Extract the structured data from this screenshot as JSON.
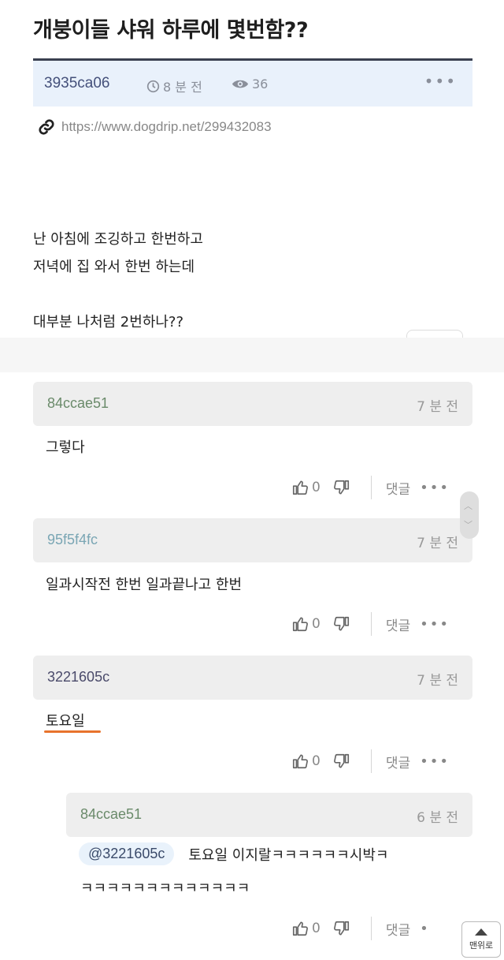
{
  "post": {
    "title": "개붕이들 샤워 하루에 몇번함??",
    "author": "3935ca06",
    "time": "8 분 전",
    "views": "36",
    "more": "•••",
    "link": "https://www.dogdrip.net/299432083",
    "lines": [
      "난 아침에 조깅하고 한번하고",
      "저녁에 집 와서 한번 하는데",
      "",
      "대부분 나처럼 2번하나??"
    ]
  },
  "comments": [
    {
      "author": "84ccae51",
      "author_color": "#6a8a6a",
      "time": "7 분 전",
      "text": "그렇다",
      "likes": "0",
      "reply": "댓글",
      "more": "•••"
    },
    {
      "author": "95f5f4fc",
      "author_color": "#7aa6b4",
      "time": "7 분 전",
      "text": "일과시작전 한번 일과끝나고 한번",
      "likes": "0",
      "reply": "댓글",
      "more": "•••"
    },
    {
      "author": "3221605c",
      "author_color": "#4a4a6a",
      "time": "7 분 전",
      "text": "토요일",
      "likes": "0",
      "reply": "댓글",
      "more": "•••"
    },
    {
      "author": "84ccae51",
      "author_color": "#6a8a6a",
      "time": "6 분 전",
      "mention": "@3221605c",
      "text_line1": "토요일 이지랄ㅋㅋㅋㅋㅋㅋ시박ㅋ",
      "text_line2": "ㅋㅋㅋㅋㅋㅋㅋㅋㅋㅋㅋㅋㅋ",
      "likes": "0",
      "reply": "댓글",
      "more": "•"
    }
  ],
  "to_top": "맨위로",
  "colors": {
    "accent_orange": "#e8732c",
    "meta_bg": "#e9f1fb",
    "comment_head_bg": "#eeeeee"
  }
}
